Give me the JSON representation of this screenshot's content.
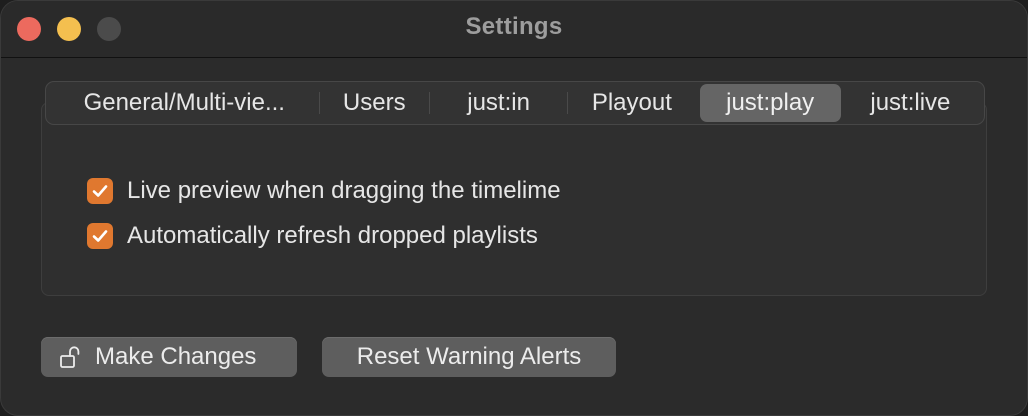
{
  "window": {
    "title": "Settings"
  },
  "tabs": [
    {
      "label": "General/Multi-vie..."
    },
    {
      "label": "Users"
    },
    {
      "label": "just:in"
    },
    {
      "label": "Playout"
    },
    {
      "label": "just:play"
    },
    {
      "label": "just:live"
    }
  ],
  "selected_tab": "just:play",
  "options": [
    {
      "label": "Live preview when dragging the timelime",
      "checked": true
    },
    {
      "label": "Automatically refresh dropped playlists",
      "checked": true
    }
  ],
  "buttons": {
    "make_changes": "Make Changes",
    "reset_warning_alerts": "Reset Warning Alerts"
  },
  "colors": {
    "accent": "#e0782f",
    "close": "#ec6a5e",
    "minimize": "#f4bf4f",
    "maximize_disabled": "#4b4b4b"
  },
  "icons": {
    "lock": "lock-open-icon",
    "check": "checkmark-icon"
  }
}
